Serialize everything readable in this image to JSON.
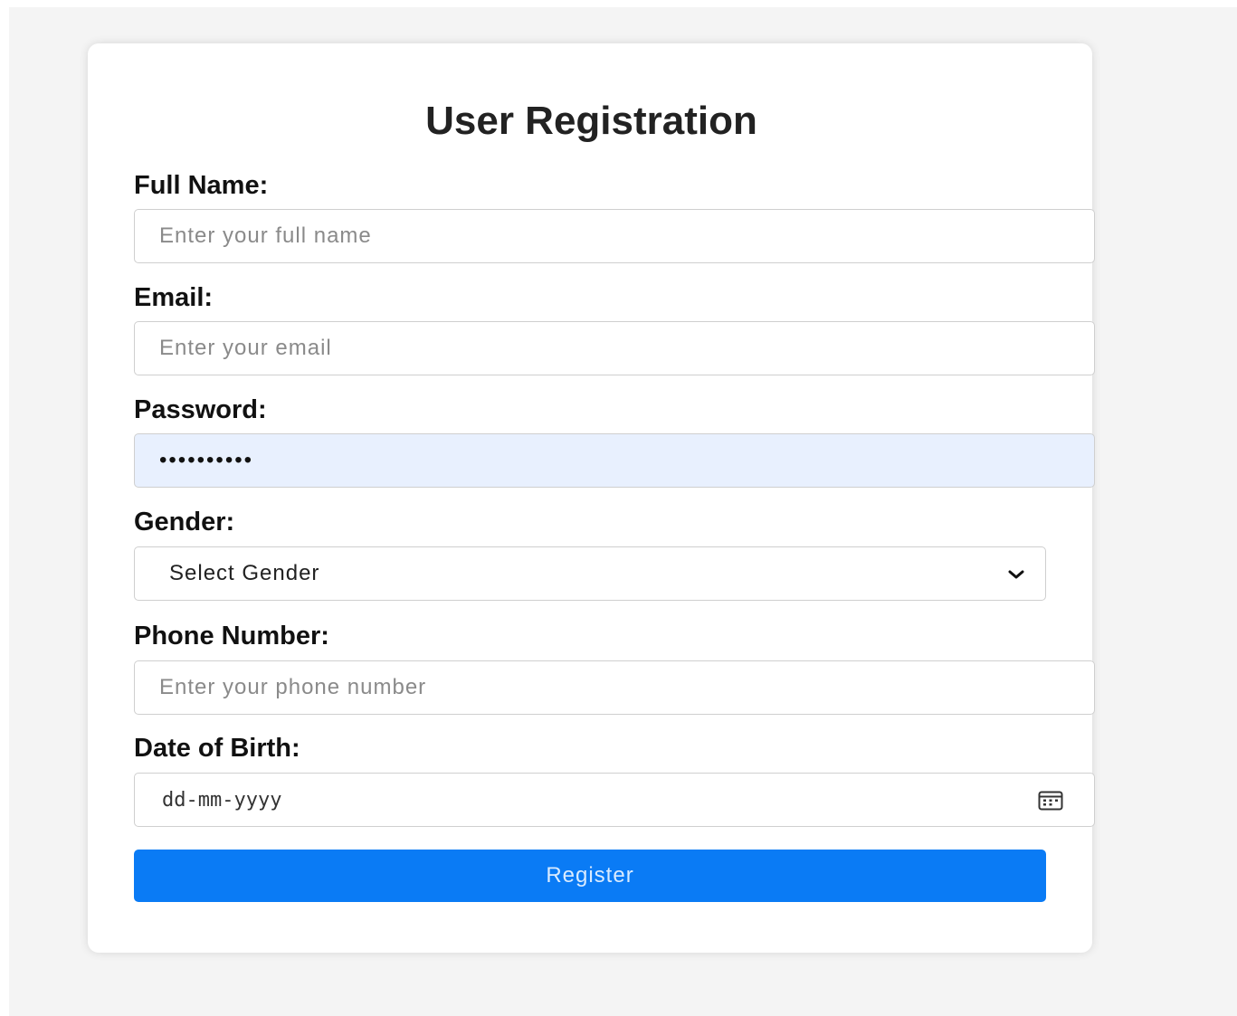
{
  "form": {
    "title": "User Registration",
    "full_name": {
      "label": "Full Name:",
      "placeholder": "Enter your full name",
      "value": ""
    },
    "email": {
      "label": "Email:",
      "placeholder": "Enter your email",
      "value": ""
    },
    "password": {
      "label": "Password:",
      "masked_value": "••••••••••"
    },
    "gender": {
      "label": "Gender:",
      "selected": "Select Gender"
    },
    "phone": {
      "label": "Phone Number:",
      "placeholder": "Enter your phone number",
      "value": ""
    },
    "dob": {
      "label": "Date of Birth:",
      "placeholder": "dd-mm-yyyy"
    },
    "submit_label": "Register"
  },
  "icons": {
    "gender_dropdown": "chevron-down-icon",
    "dob_picker": "calendar-icon"
  },
  "colors": {
    "accent": "#0a7bf5",
    "autofill_bg": "#e8f0fe",
    "page_bg": "#f4f4f4"
  }
}
